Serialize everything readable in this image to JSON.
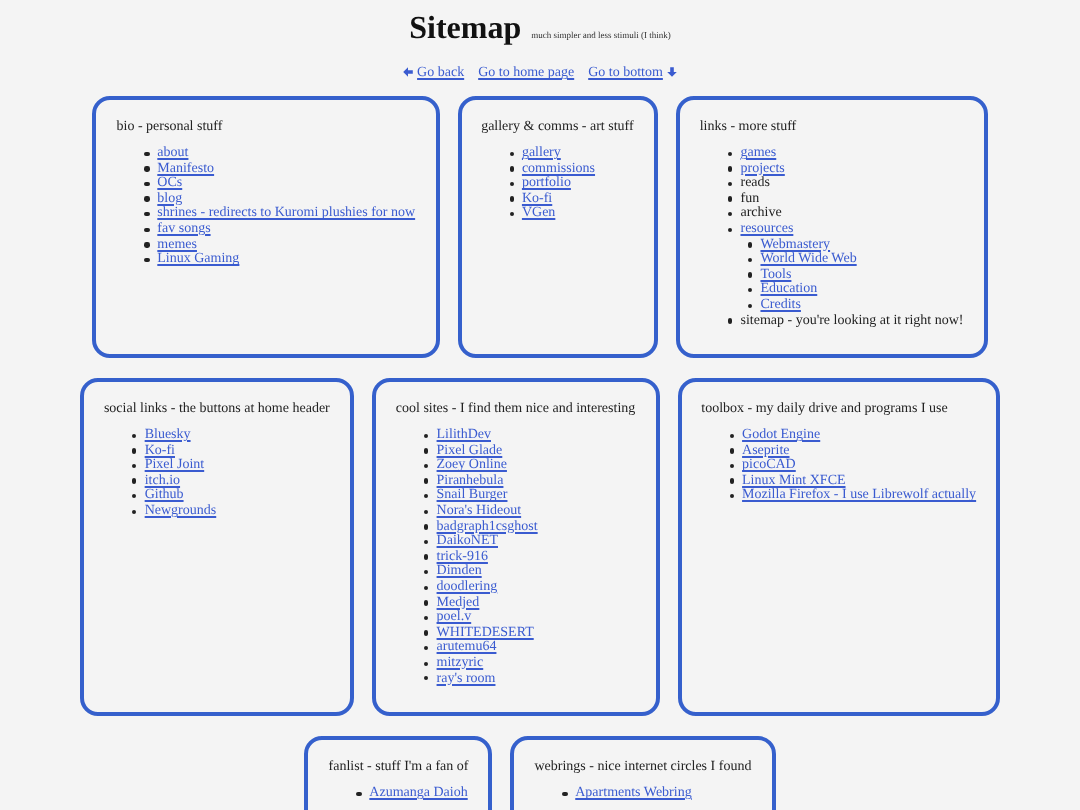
{
  "header": {
    "title": "Sitemap",
    "subtitle": "much simpler and less stimuli (I think)"
  },
  "nav": [
    {
      "kind": "back",
      "label": "Go back"
    },
    {
      "kind": "plain",
      "label": "Go to home page"
    },
    {
      "kind": "down",
      "label": "Go to bottom"
    }
  ],
  "rows": [
    {
      "cards": [
        {
          "title": "bio - personal stuff",
          "items": [
            {
              "kind": "link",
              "label": "about"
            },
            {
              "kind": "link",
              "label": "Manifesto"
            },
            {
              "kind": "link",
              "label": "OCs"
            },
            {
              "kind": "link",
              "label": "blog"
            },
            {
              "kind": "link",
              "label": "shrines - redirects to Kuromi plushies for now"
            },
            {
              "kind": "link",
              "label": "fav songs"
            },
            {
              "kind": "link",
              "label": "memes"
            },
            {
              "kind": "link",
              "label": "Linux Gaming"
            }
          ]
        },
        {
          "title": "gallery & comms - art stuff",
          "items": [
            {
              "kind": "link",
              "label": "gallery"
            },
            {
              "kind": "link",
              "label": "commissions"
            },
            {
              "kind": "link",
              "label": "portfolio"
            },
            {
              "kind": "link",
              "label": "Ko-fi"
            },
            {
              "kind": "link",
              "label": "VGen"
            }
          ]
        },
        {
          "title": "links - more stuff",
          "items": [
            {
              "kind": "link",
              "label": "games"
            },
            {
              "kind": "link",
              "label": "projects"
            },
            {
              "kind": "text",
              "label": "reads"
            },
            {
              "kind": "text",
              "label": "fun"
            },
            {
              "kind": "text",
              "label": "archive"
            },
            {
              "kind": "link",
              "label": "resources",
              "children": [
                {
                  "kind": "link",
                  "label": "Webmastery"
                },
                {
                  "kind": "link",
                  "label": "World Wide Web"
                },
                {
                  "kind": "link",
                  "label": "Tools"
                },
                {
                  "kind": "link",
                  "label": "Education"
                },
                {
                  "kind": "link",
                  "label": "Credits"
                }
              ]
            },
            {
              "kind": "text",
              "label": "sitemap - you're looking at it right now!"
            }
          ]
        }
      ]
    },
    {
      "cards": [
        {
          "title": "social links - the buttons at home header",
          "items": [
            {
              "kind": "link",
              "label": "Bluesky"
            },
            {
              "kind": "link",
              "label": "Ko-fi"
            },
            {
              "kind": "link",
              "label": "Pixel Joint"
            },
            {
              "kind": "link",
              "label": "itch.io"
            },
            {
              "kind": "link",
              "label": "Github"
            },
            {
              "kind": "link",
              "label": "Newgrounds"
            }
          ]
        },
        {
          "title": "cool sites - I find them nice and interesting",
          "items": [
            {
              "kind": "link",
              "label": "LilithDev"
            },
            {
              "kind": "link",
              "label": "Pixel Glade"
            },
            {
              "kind": "link",
              "label": "Zoey Online"
            },
            {
              "kind": "link",
              "label": "Piranhebula"
            },
            {
              "kind": "link",
              "label": "Snail Burger"
            },
            {
              "kind": "link",
              "label": "Nora's Hideout"
            },
            {
              "kind": "link",
              "label": "badgraph1csghost"
            },
            {
              "kind": "link",
              "label": "DaikoNET"
            },
            {
              "kind": "link",
              "label": "trick-916"
            },
            {
              "kind": "link",
              "label": "Dimden"
            },
            {
              "kind": "link",
              "label": "doodlering"
            },
            {
              "kind": "link",
              "label": "Medjed"
            },
            {
              "kind": "link",
              "label": "poel.v"
            },
            {
              "kind": "link",
              "label": "WHITEDESERT"
            },
            {
              "kind": "link",
              "label": "arutemu64"
            },
            {
              "kind": "link",
              "label": "mitzyric"
            },
            {
              "kind": "link",
              "label": "ray's room"
            }
          ]
        },
        {
          "title": "toolbox - my daily drive and programs I use",
          "items": [
            {
              "kind": "link",
              "label": "Godot Engine"
            },
            {
              "kind": "link",
              "label": "Aseprite"
            },
            {
              "kind": "link",
              "label": "picoCAD"
            },
            {
              "kind": "link",
              "label": "Linux Mint XFCE"
            },
            {
              "kind": "link",
              "label": "Mozilla Firefox - I use Librewolf actually"
            }
          ]
        }
      ]
    },
    {
      "cards": [
        {
          "title": "fanlist - stuff I'm a fan of",
          "items": [
            {
              "kind": "link",
              "label": "Azumanga Daioh"
            }
          ]
        },
        {
          "title": "webrings - nice internet circles I found",
          "items": [
            {
              "kind": "link",
              "label": "Apartments Webring"
            }
          ]
        }
      ]
    }
  ]
}
